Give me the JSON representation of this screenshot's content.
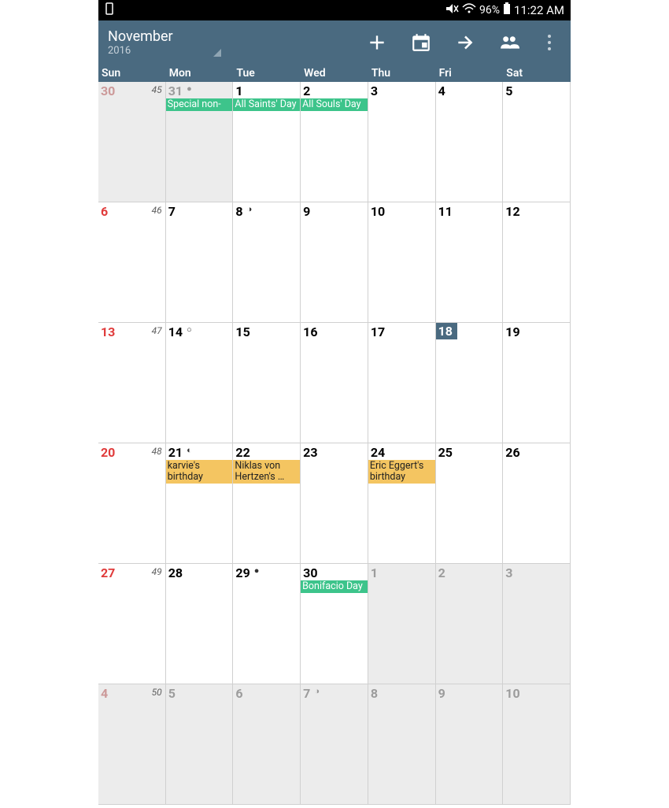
{
  "status": {
    "battery_pct": "96%",
    "time": "11:22 AM"
  },
  "header": {
    "month": "November",
    "year": "2016"
  },
  "weekdays": [
    "Sun",
    "Mon",
    "Tue",
    "Wed",
    "Thu",
    "Fri",
    "Sat"
  ],
  "weeks": [
    {
      "weeknum": "45",
      "days": [
        {
          "num": "30",
          "sun": true,
          "other": true
        },
        {
          "num": "31",
          "other": true,
          "moon": "●",
          "moonColor": "#9a9a9a",
          "events": [
            {
              "t": "Special non-",
              "c": "green"
            }
          ]
        },
        {
          "num": "1",
          "events": [
            {
              "t": "All Saints' Day",
              "c": "green"
            }
          ]
        },
        {
          "num": "2",
          "events": [
            {
              "t": "All Souls' Day",
              "c": "green"
            }
          ]
        },
        {
          "num": "3"
        },
        {
          "num": "4"
        },
        {
          "num": "5"
        }
      ]
    },
    {
      "weeknum": "46",
      "days": [
        {
          "num": "6",
          "sun": true
        },
        {
          "num": "7"
        },
        {
          "num": "8",
          "moon": "◑"
        },
        {
          "num": "9"
        },
        {
          "num": "10"
        },
        {
          "num": "11"
        },
        {
          "num": "12"
        }
      ]
    },
    {
      "weeknum": "47",
      "days": [
        {
          "num": "13",
          "sun": true
        },
        {
          "num": "14",
          "moon": "○"
        },
        {
          "num": "15"
        },
        {
          "num": "16"
        },
        {
          "num": "17"
        },
        {
          "num": "18",
          "today": true
        },
        {
          "num": "19"
        }
      ]
    },
    {
      "weeknum": "48",
      "days": [
        {
          "num": "20",
          "sun": true
        },
        {
          "num": "21",
          "moon": "◐",
          "events": [
            {
              "t": "karvie's birthday",
              "c": "yellow"
            }
          ]
        },
        {
          "num": "22",
          "events": [
            {
              "t": "Niklas von Hertzen's …",
              "c": "yellow"
            }
          ]
        },
        {
          "num": "23"
        },
        {
          "num": "24",
          "events": [
            {
              "t": "Eric Eggert's birthday",
              "c": "yellow"
            }
          ]
        },
        {
          "num": "25"
        },
        {
          "num": "26"
        }
      ]
    },
    {
      "weeknum": "49",
      "days": [
        {
          "num": "27",
          "sun": true
        },
        {
          "num": "28"
        },
        {
          "num": "29",
          "moon": "●"
        },
        {
          "num": "30",
          "events": [
            {
              "t": "Bonifacio Day",
              "c": "green"
            }
          ]
        },
        {
          "num": "1",
          "other": true
        },
        {
          "num": "2",
          "other": true
        },
        {
          "num": "3",
          "other": true
        }
      ]
    },
    {
      "weeknum": "50",
      "days": [
        {
          "num": "4",
          "sun": true,
          "other": true
        },
        {
          "num": "5",
          "other": true
        },
        {
          "num": "6",
          "other": true
        },
        {
          "num": "7",
          "other": true,
          "moon": "◑",
          "moonColor": "#9a9a9a"
        },
        {
          "num": "8",
          "other": true
        },
        {
          "num": "9",
          "other": true
        },
        {
          "num": "10",
          "other": true
        }
      ]
    }
  ]
}
